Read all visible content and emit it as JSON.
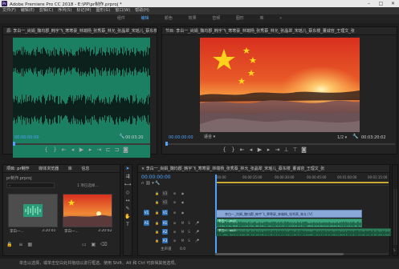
{
  "app": {
    "title": "Adobe Premiere Pro CC 2018 - E:\\PP\\pr制作.prproj *",
    "icon_label": "Pr",
    "window_controls": [
      "minimize-icon",
      "maximize-icon",
      "close-icon"
    ]
  },
  "menu": [
    "文件(F)",
    "编辑(E)",
    "剪辑(C)",
    "序列(S)",
    "标记(M)",
    "图形(G)",
    "窗口(W)",
    "帮助(H)"
  ],
  "workspace": {
    "items": [
      "组件",
      "编辑",
      "颜色",
      "效果",
      "音频",
      "图形",
      "库"
    ],
    "active_index": 1
  },
  "source_monitor": {
    "title": "源: 李白一_尚娟_魏均郡_韩宇飞_寒寒豪_林端杨_张秀蔡_林允_张晶翠_宋瑶儿_蔡东楼_董诚容_王理文_张",
    "timecode_in": "00:00:00:00",
    "timecode_duration": "00:03:20",
    "accent_color": "#1b7f62"
  },
  "program_monitor": {
    "title": "节目: 李白一_尚娟_魏均郡_韩宇飞_寒寒豪_林端杨_张秀蔡_林允_张晶翠_宋瑶儿_蔡东楼_董诚容_王理文_张",
    "timecode_in": "00:00:00:00",
    "timecode_duration": "00:03:20:02",
    "fit_label": "适合",
    "resolution_label": "1/2"
  },
  "project_panel": {
    "tabs": [
      "项目: pr制作",
      "媒体浏览器",
      "库",
      "信息"
    ],
    "file": "pr制作.prproj",
    "selection_count": "1 项已选择...",
    "items": [
      {
        "name": "李白一...",
        "duration": "3:20:05"
      },
      {
        "name": "李白一...",
        "duration": "3:20:02"
      }
    ]
  },
  "timeline": {
    "title": "李白一_尚娟_魏均郡_韩宇飞_寒寒豪_林端杨_张秀蔡_林允_张晶翠_宋瑶儿_蔡东楼_董诚容_王理文_张",
    "timecode": "00:00:00:00",
    "ruler": [
      "00:00",
      "00:00:15:00",
      "00:00:30:00",
      "00:00:45:00",
      "00:01:00:00",
      "00:01:15:00"
    ],
    "tracks": [
      "V3",
      "V2",
      "V1",
      "A1",
      "A2",
      "A3"
    ],
    "master": {
      "label": "主声道",
      "value": "0.0"
    },
    "clip_name": "李白一_尚娟_魏均郡_韩宇飞_寒寒豪_林端杨_张秀蔡_林允 [V]",
    "audio_clip_label": "李白一...mp3",
    "audio_clip_label2": "李白一...mp3"
  },
  "status": "单击以选择，或单击空白处并拖动以进行框选。使用 Shift、Alt 和 Ctrl 可获得其他选项。",
  "colors": {
    "accent_blue": "#2d8ceb",
    "timecode_blue": "#4ea3ff",
    "waveform_green": "#1b7f62",
    "video_track_clip": "#8aa8d8",
    "audio_track_clip": "#2e7d5b"
  }
}
